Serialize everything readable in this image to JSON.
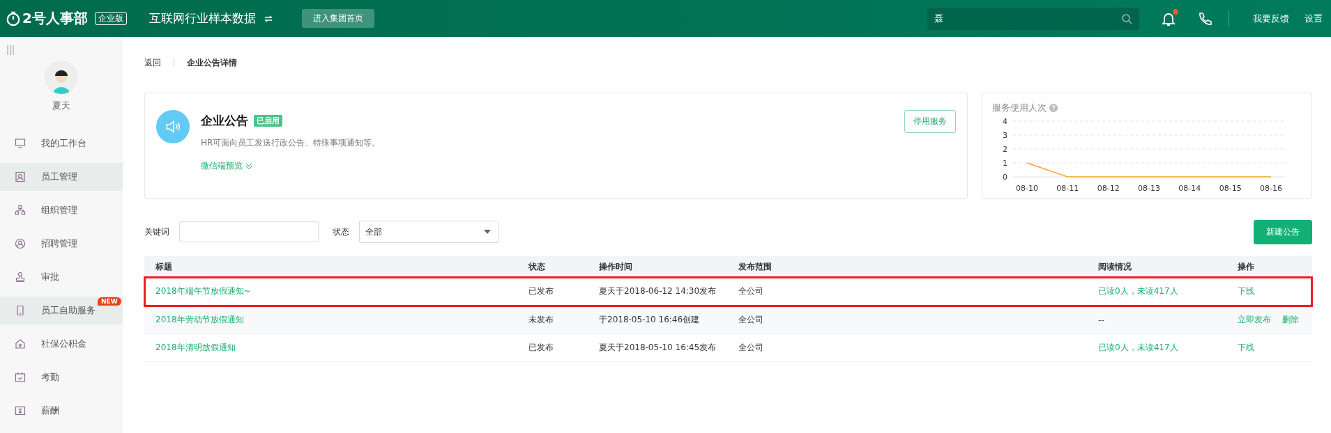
{
  "topbar": {
    "logo": "2号人事部",
    "edition": "企业版",
    "company": "互联网行业样本数据",
    "group_button": "进入集团首页",
    "search_value": "聂",
    "notification_dot": true,
    "links": [
      "我要反馈",
      "设置"
    ]
  },
  "sidebar": {
    "user": "夏天",
    "items": [
      {
        "label": "我的工作台",
        "selected": false
      },
      {
        "label": "员工管理",
        "selected": true
      },
      {
        "label": "组织管理",
        "selected": false
      },
      {
        "label": "招聘管理",
        "selected": false
      },
      {
        "label": "审批",
        "selected": false
      },
      {
        "label": "员工自助服务",
        "selected": true,
        "badge": "NEW"
      },
      {
        "label": "社保公积金",
        "selected": false
      },
      {
        "label": "考勤",
        "selected": false
      },
      {
        "label": "薪酬",
        "selected": false
      }
    ]
  },
  "breadcrumb": {
    "back": "返回",
    "current": "企业公告详情"
  },
  "service": {
    "title": "企业公告",
    "status": "已启用",
    "enabled": true,
    "description": "HR可面向员工发送行政公告、特殊事项通知等。",
    "preview_link": "微信端预览",
    "stop_button": "停用服务"
  },
  "usage_chart": {
    "title": "服务使用人次",
    "chart_data": {
      "type": "line",
      "categories": [
        "08-10",
        "08-11",
        "08-12",
        "08-13",
        "08-14",
        "08-15",
        "08-16"
      ],
      "ylim": [
        0,
        4
      ],
      "yticks": [
        0,
        1,
        2,
        3,
        4
      ],
      "grid": true,
      "series": [
        {
          "color": "#f5a623",
          "values": [
            1,
            0,
            0,
            0,
            0,
            0,
            0
          ]
        }
      ]
    }
  },
  "filters": {
    "keyword_label": "关键词",
    "status_label": "状态",
    "status_value": "全部",
    "new_button": "新建公告"
  },
  "table": {
    "columns": [
      "标题",
      "状态",
      "操作时间",
      "发布范围",
      "阅读情况",
      "操作"
    ],
    "rows": [
      {
        "title": "2018年端午节放假通知~",
        "status": "已发布",
        "time": "夏天于2018-06-12 14:30发布",
        "scope": "全公司",
        "reading": {
          "text": "已读0人，未读417人",
          "kind": "count"
        },
        "actions": [
          "下线"
        ],
        "highlighted": true
      },
      {
        "title": "2018年劳动节放假通知",
        "status": "未发布",
        "time": "于2018-05-10 16:46创建",
        "scope": "全公司",
        "reading": {
          "text": "--",
          "kind": "empty"
        },
        "actions": [
          "立即发布",
          "删除"
        ],
        "highlighted": false
      },
      {
        "title": "2018年清明放假通知",
        "status": "已发布",
        "time": "夏天于2018-05-10 16:45发布",
        "scope": "全公司",
        "reading": {
          "text": "已读0人，未读417人",
          "kind": "count"
        },
        "actions": [
          "下线"
        ],
        "highlighted": false
      }
    ]
  }
}
